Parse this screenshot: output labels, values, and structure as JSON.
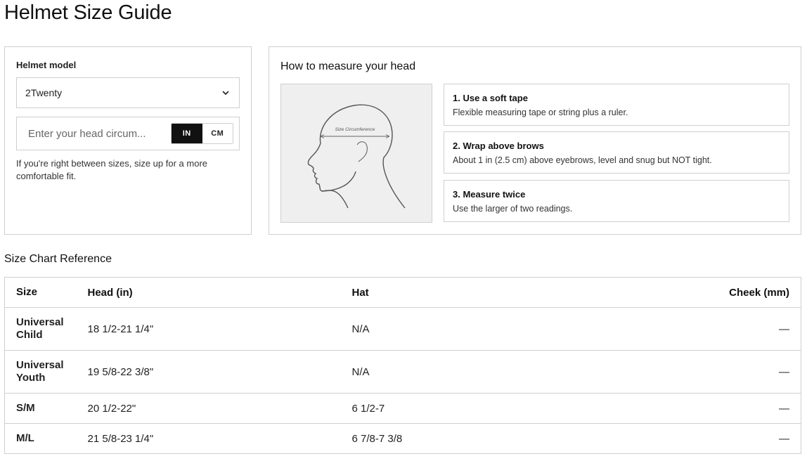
{
  "page": {
    "title": "Helmet Size Guide"
  },
  "finder": {
    "model_label": "Helmet model",
    "model_value": "2Twenty",
    "input_placeholder": "Enter your head circum...",
    "units": [
      "IN",
      "CM"
    ],
    "active_unit": "IN",
    "hint": "If you're right between sizes, size up for a more comfortable fit."
  },
  "howto": {
    "title": "How to measure your head",
    "illustration_label": "Size Circumference",
    "steps": [
      {
        "title": "1. Use a soft tape",
        "desc": "Flexible measuring tape or string plus a ruler."
      },
      {
        "title": "2. Wrap above brows",
        "desc": "About 1 in (2.5 cm) above eyebrows, level and snug but NOT tight."
      },
      {
        "title": "3. Measure twice",
        "desc": "Use the larger of two readings."
      }
    ]
  },
  "chart": {
    "title": "Size Chart Reference",
    "headers": [
      "Size",
      "Head (in)",
      "Hat",
      "Cheek (mm)"
    ],
    "rows": [
      {
        "size": "Universal Child",
        "head": "18 1/2-21 1/4\"",
        "hat": "N/A",
        "cheek": "—"
      },
      {
        "size": "Universal Youth",
        "head": "19 5/8-22 3/8\"",
        "hat": "N/A",
        "cheek": "—"
      },
      {
        "size": "S/M",
        "head": "20 1/2-22\"",
        "hat": "6 1/2-7",
        "cheek": "—"
      },
      {
        "size": "M/L",
        "head": "21 5/8-23 1/4\"",
        "hat": "6 7/8-7 3/8",
        "cheek": "—"
      }
    ]
  }
}
